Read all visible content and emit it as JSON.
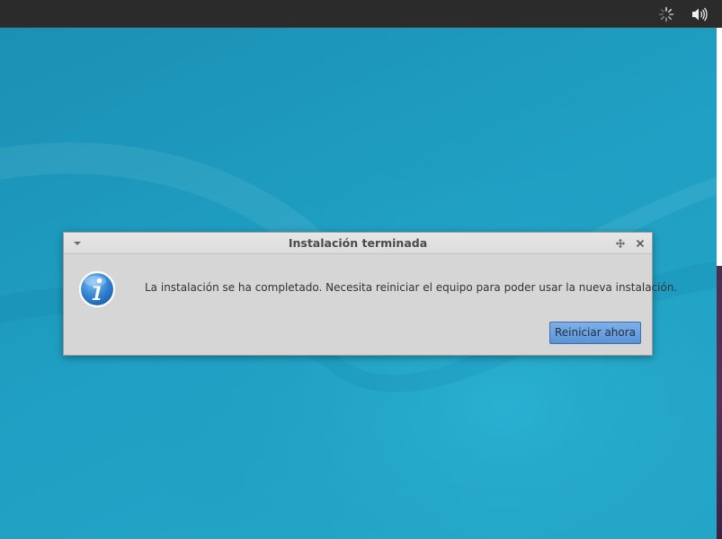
{
  "top_panel": {
    "indicators": [
      {
        "icon": "network-busy-spinner-icon"
      },
      {
        "icon": "volume-icon"
      }
    ]
  },
  "dialog": {
    "title": "Instalación terminada",
    "icon": "info-icon",
    "message": "La instalación se ha completado. Necesita reiniciar el equipo para poder usar la nueva instalación.",
    "primary_button_label": "Reiniciar ahora",
    "titlebar_buttons": [
      "window-menu-icon",
      "pin-icon",
      "close-icon"
    ]
  },
  "colors": {
    "desktop_background": "#1f9cbd",
    "panel": "#2b2b2b",
    "dialog_background": "#d6d6d6",
    "primary_button": "#5a93d6",
    "info_icon": "#2f7fd0"
  }
}
